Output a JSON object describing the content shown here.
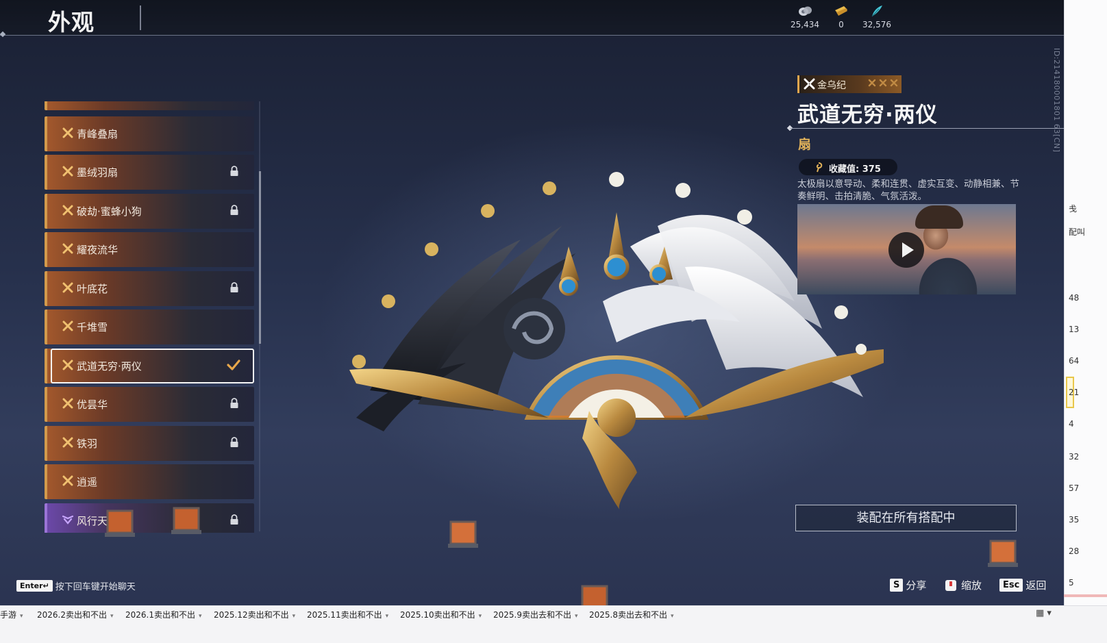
{
  "header": {
    "title": "外观",
    "currencies": [
      {
        "icon": "silver-coin-icon",
        "value": "25,434"
      },
      {
        "icon": "ticket-icon",
        "value": "0"
      },
      {
        "icon": "feather-icon",
        "value": "32,576"
      }
    ],
    "id_text": "ID:214180001801 63[CN]"
  },
  "list": {
    "items": [
      {
        "label": "",
        "locked": false
      },
      {
        "label": "青峰叠扇",
        "locked": false
      },
      {
        "label": "墨绒羽扇",
        "locked": true
      },
      {
        "label": "破劫·蜜蜂小狗",
        "locked": true
      },
      {
        "label": "耀夜流华",
        "locked": false
      },
      {
        "label": "叶底花",
        "locked": true
      },
      {
        "label": "千堆雪",
        "locked": false
      },
      {
        "label": "武道无穷·两仪",
        "locked": false,
        "selected": true
      },
      {
        "label": "优昙华",
        "locked": true
      },
      {
        "label": "铁羽",
        "locked": true
      },
      {
        "label": "逍遥",
        "locked": false
      },
      {
        "label": "风行天·逸",
        "locked": true,
        "rarity": "purple"
      }
    ]
  },
  "detail": {
    "series": "金乌纪",
    "name": "武道无穷·两仪",
    "type": "扇",
    "collection": "收藏值: 375",
    "description": "太极扇以意导动、柔和连贯、虚实互变、动静相兼、节奏鲜明、击拍清脆、气氛活泼。",
    "equip_button": "装配在所有搭配中"
  },
  "hints": {
    "chat_key": "Enter↵",
    "chat_text": "按下回车键开始聊天",
    "share_key": "S",
    "share_text": "分享",
    "zoom_text": "缩放",
    "back_key": "Esc",
    "back_text": "返回"
  },
  "tabs": [
    "手游",
    "2026.2卖出和不出",
    "2026.1卖出和不出",
    "2025.12卖出和不出",
    "2025.11卖出和不出",
    "2025.10卖出和不出",
    "2025.9卖出去和不出",
    "2025.8卖出去和不出"
  ],
  "sidebar_fragments": [
    "戋",
    "配叫",
    "48",
    "13",
    "64",
    "21",
    "4",
    "32",
    "57",
    "35",
    "28",
    "5"
  ],
  "colors": {
    "accent_gold": "#e2b35a",
    "item_orange": "#d29a4c",
    "rarity_purple": "#9a74d6"
  }
}
